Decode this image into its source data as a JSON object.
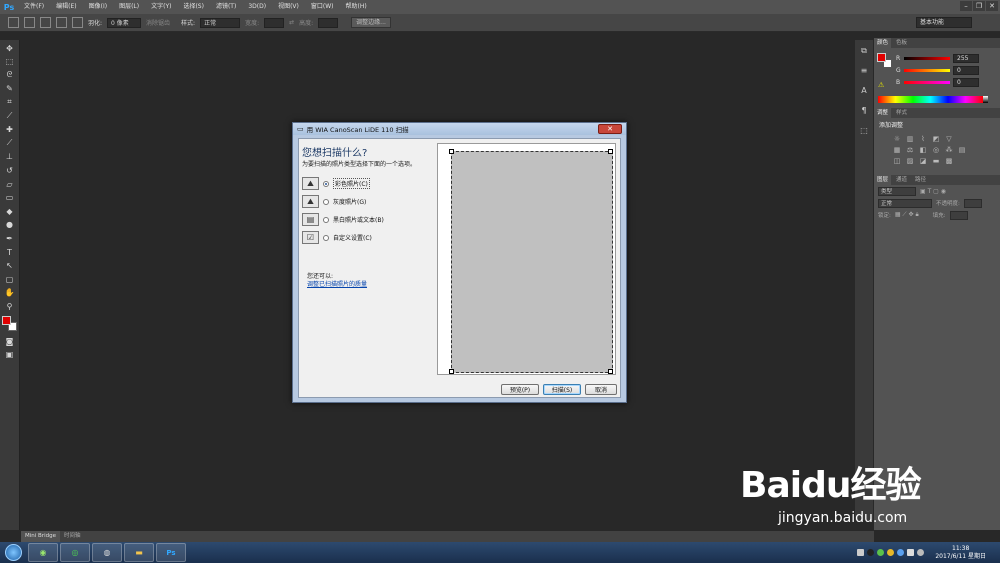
{
  "app": {
    "logo": "Ps",
    "menu": [
      "文件(F)",
      "编辑(E)",
      "图像(I)",
      "图层(L)",
      "文字(Y)",
      "选择(S)",
      "滤镜(T)",
      "3D(D)",
      "视图(V)",
      "窗口(W)",
      "帮助(H)"
    ],
    "window_controls": [
      "–",
      "❐",
      "✕"
    ]
  },
  "options_bar": {
    "feather_label": "羽化:",
    "feather_value": "0 像素",
    "antialias_label": "消除锯齿",
    "style_label": "样式:",
    "style_value": "正常",
    "width_label": "宽度:",
    "height_label": "高度:",
    "refine_button": "调整边缘...",
    "workspace": "基本功能"
  },
  "color_panel": {
    "tabs": [
      "颜色",
      "色板"
    ],
    "r_label": "R",
    "r_value": "255",
    "g_label": "G",
    "g_value": "0",
    "b_label": "B",
    "b_value": "0",
    "fg_color": "#e00000"
  },
  "adjust_panel": {
    "tabs": [
      "调整",
      "样式"
    ],
    "heading": "添加调整"
  },
  "layers_panel": {
    "tabs": [
      "图层",
      "通道",
      "路径"
    ],
    "kind_label": "类型",
    "blend_mode": "正常",
    "opacity_label": "不透明度:",
    "lock_label": "锁定:",
    "fill_label": "填充:"
  },
  "bottom_tabs": [
    "Mini Bridge",
    "时间轴"
  ],
  "dialog": {
    "title": "用 WIA CanoScan LiDE 110 扫描",
    "question": "您想扫描什么?",
    "subtitle": "为要扫描的照片类型选择下面的一个选项。",
    "options": [
      "彩色照片(C)",
      "灰度照片(G)",
      "黑白照片或文本(B)",
      "自定义设置(C)"
    ],
    "also_label": "您还可以:",
    "link": "调整已扫描照片的质量",
    "preview_button": "预览(P)",
    "scan_button": "扫描(S)",
    "cancel_button": "取消"
  },
  "taskbar": {
    "time": "11:38",
    "date": "2017/6/11 星期日"
  },
  "watermark": {
    "logo": "Baidu经验",
    "url": "jingyan.baidu.com"
  }
}
